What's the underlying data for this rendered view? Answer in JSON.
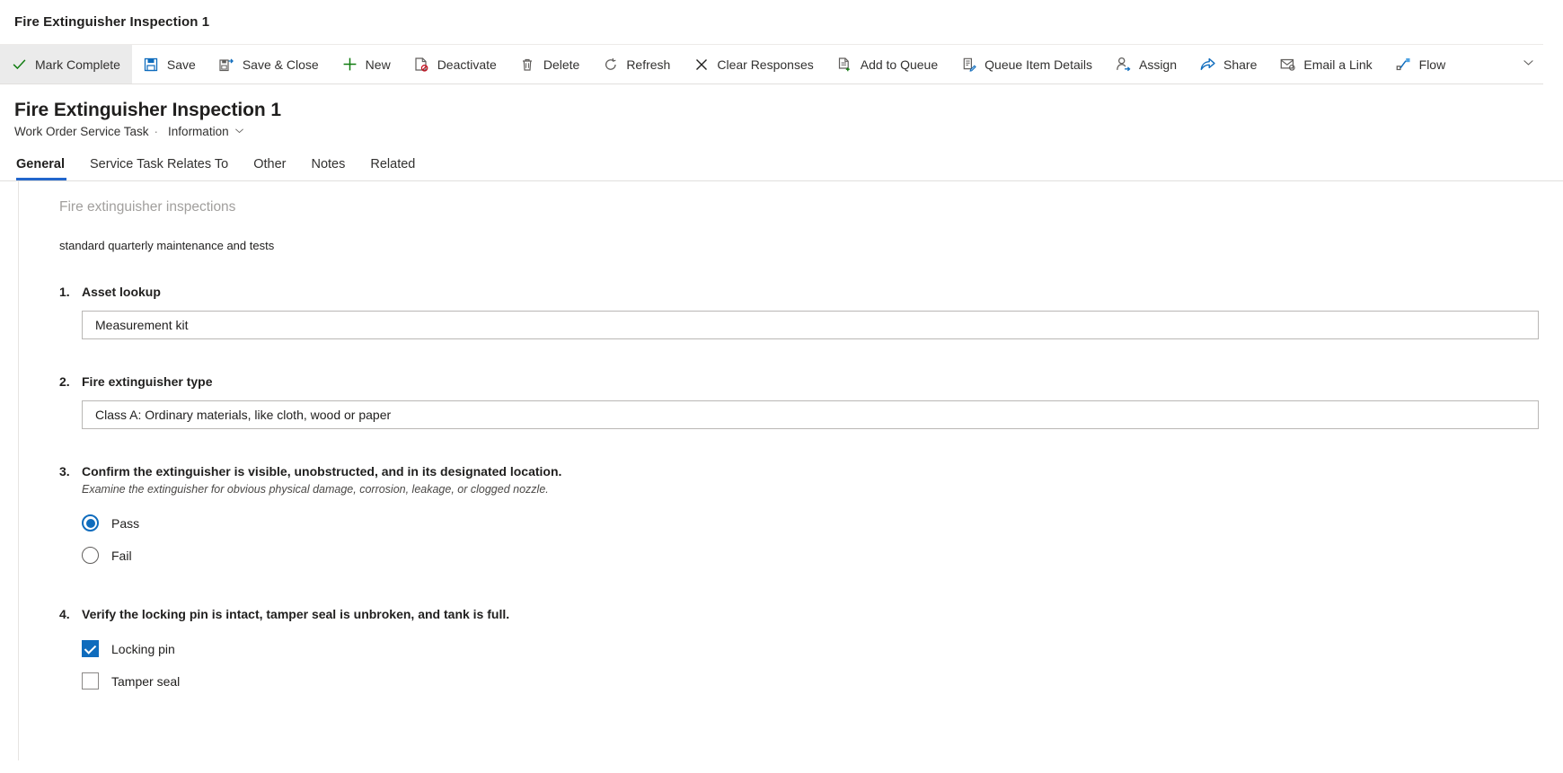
{
  "window": {
    "title": "Fire Extinguisher Inspection 1"
  },
  "commandbar": {
    "buttons": [
      {
        "label": "Mark Complete",
        "icon": "checkmark-icon",
        "active": true
      },
      {
        "label": "Save",
        "icon": "save-icon",
        "active": false
      },
      {
        "label": "Save & Close",
        "icon": "save-and-close-icon",
        "active": false
      },
      {
        "label": "New",
        "icon": "plus-icon",
        "active": false
      },
      {
        "label": "Deactivate",
        "icon": "deactivate-icon",
        "active": false
      },
      {
        "label": "Delete",
        "icon": "trash-icon",
        "active": false
      },
      {
        "label": "Refresh",
        "icon": "refresh-icon",
        "active": false
      },
      {
        "label": "Clear Responses",
        "icon": "close-x-icon",
        "active": false
      },
      {
        "label": "Add to Queue",
        "icon": "add-to-queue-icon",
        "active": false
      },
      {
        "label": "Queue Item Details",
        "icon": "queue-details-icon",
        "active": false
      },
      {
        "label": "Assign",
        "icon": "assign-person-icon",
        "active": false
      },
      {
        "label": "Share",
        "icon": "share-icon",
        "active": false
      },
      {
        "label": "Email a Link",
        "icon": "email-link-icon",
        "active": false
      },
      {
        "label": "Flow",
        "icon": "flow-icon",
        "active": false
      }
    ],
    "overflow_icon": "chevron-down-icon"
  },
  "record": {
    "title": "Fire Extinguisher Inspection 1",
    "entity": "Work Order Service Task",
    "separator": "·",
    "form_name": "Information"
  },
  "tabs": [
    {
      "label": "General",
      "selected": true
    },
    {
      "label": "Service Task Relates To",
      "selected": false
    },
    {
      "label": "Other",
      "selected": false
    },
    {
      "label": "Notes",
      "selected": false
    },
    {
      "label": "Related",
      "selected": false
    }
  ],
  "form": {
    "section_title": "Fire extinguisher inspections",
    "section_description": "standard quarterly maintenance and tests",
    "questions": [
      {
        "number": "1.",
        "label": "Asset lookup",
        "type": "text",
        "value": "Measurement kit"
      },
      {
        "number": "2.",
        "label": "Fire extinguisher type",
        "type": "text",
        "value": "Class A: Ordinary materials, like cloth, wood or paper"
      },
      {
        "number": "3.",
        "label": "Confirm the extinguisher is visible, unobstructed, and in its designated location.",
        "sublabel": "Examine the extinguisher for obvious physical damage, corrosion, leakage, or clogged nozzle.",
        "type": "radio",
        "options": [
          {
            "label": "Pass",
            "checked": true
          },
          {
            "label": "Fail",
            "checked": false
          }
        ]
      },
      {
        "number": "4.",
        "label": "Verify the locking pin is intact, tamper seal is unbroken, and tank is full.",
        "type": "checkbox",
        "options": [
          {
            "label": "Locking pin",
            "checked": true
          },
          {
            "label": "Tamper seal",
            "checked": false
          }
        ]
      }
    ]
  },
  "colors": {
    "accent": "#0f6cbd",
    "tab_underline": "#2266cc",
    "icon_blue": "#0f6cbd",
    "icon_green": "#107c10",
    "icon_gray": "#605e5c"
  }
}
